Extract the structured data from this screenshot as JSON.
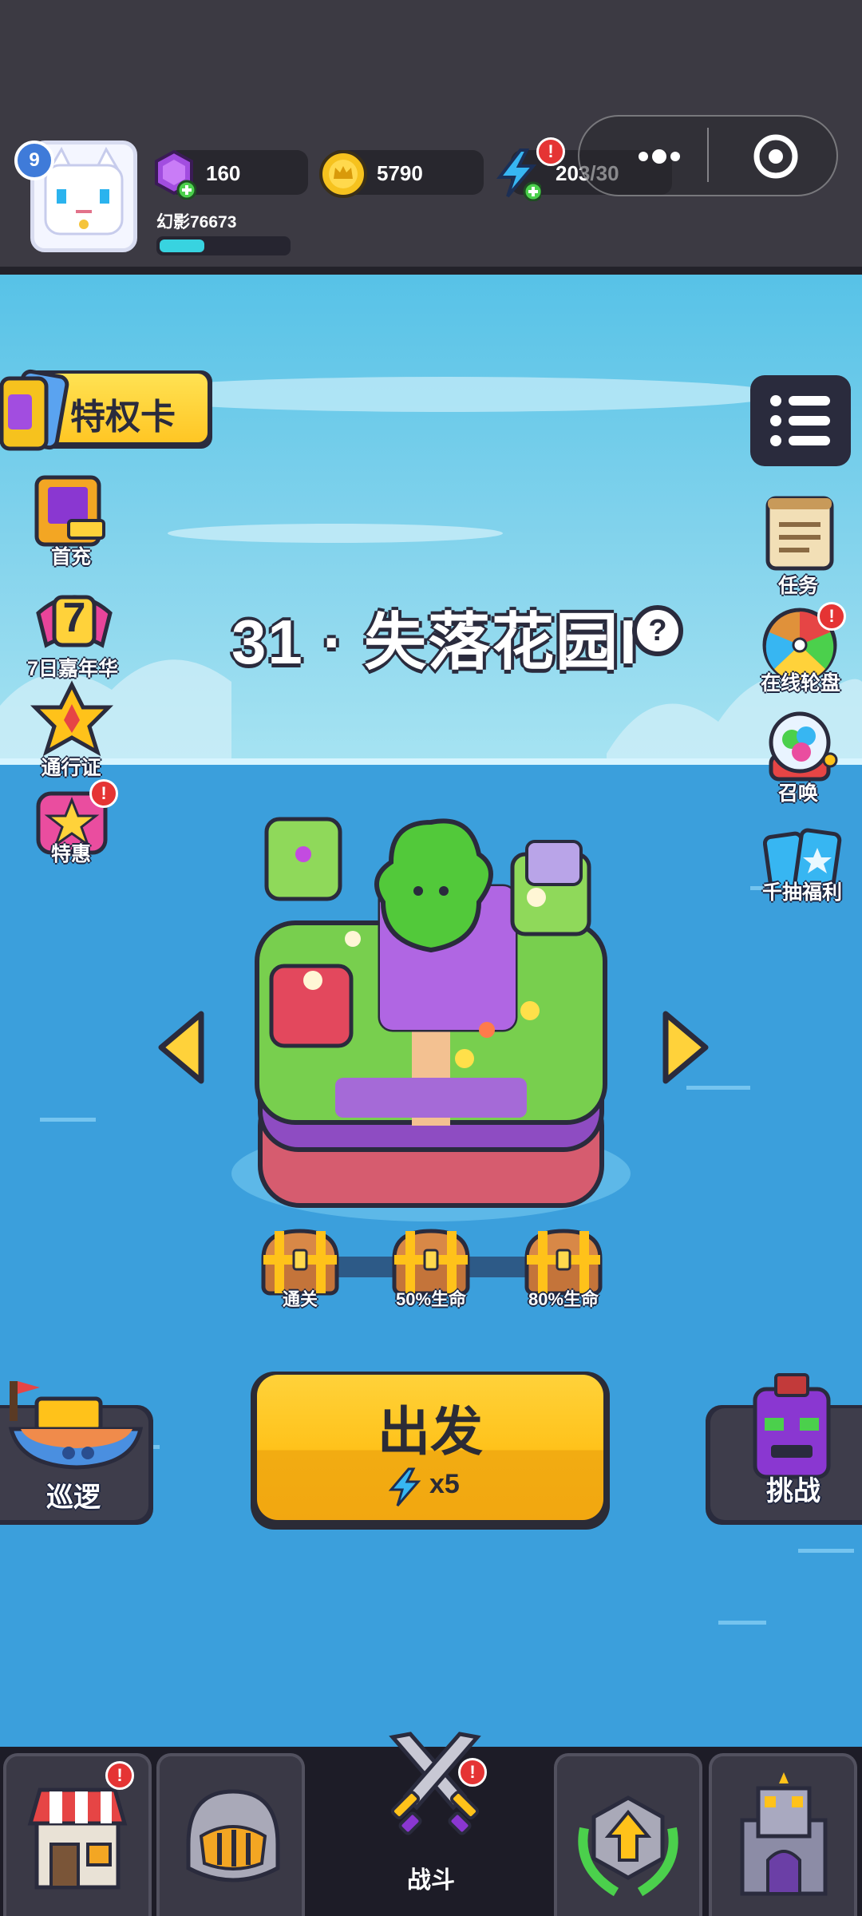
{
  "player": {
    "level": "9",
    "name": "幻影76673",
    "xp_progress": 0.35
  },
  "resources": {
    "gems": "160",
    "coins": "5790",
    "energy": "203/30"
  },
  "left_menu": {
    "privilege_card": "特权卡",
    "first_recharge": "首充",
    "carnival_number": "7",
    "carnival": "7日嘉年华",
    "pass": "通行证",
    "special_offer": "特惠"
  },
  "right_menu": {
    "tasks": "任务",
    "wheel": "在线轮盘",
    "summon": "召唤",
    "draw_bonus": "千抽福利"
  },
  "stage": {
    "title": "31 · 失落花园I",
    "help": "?"
  },
  "chests": [
    {
      "label": "通关"
    },
    {
      "label": "50%生命"
    },
    {
      "label": "80%生命"
    }
  ],
  "actions": {
    "patrol": "巡逻",
    "go": "出发",
    "go_cost": "x5",
    "challenge": "挑战"
  },
  "nav": {
    "battle": "战斗"
  },
  "alert": "!",
  "colors": {
    "go_button": "#ffc21a",
    "top_bar": "#3c3a43",
    "sea": "#3b9fdc",
    "alert": "#e53434",
    "xp": "#38d3e0"
  },
  "icons": [
    "gem-icon",
    "coin-icon",
    "lightning-icon",
    "menu-icon",
    "clock-icon",
    "scroll-icon",
    "wheel-icon",
    "summon-orb-icon",
    "cards-icon",
    "chest-icon",
    "ship-icon",
    "demon-totem-icon",
    "shop-icon",
    "helmet-icon",
    "swords-icon",
    "upgrade-icon",
    "castle-icon"
  ]
}
